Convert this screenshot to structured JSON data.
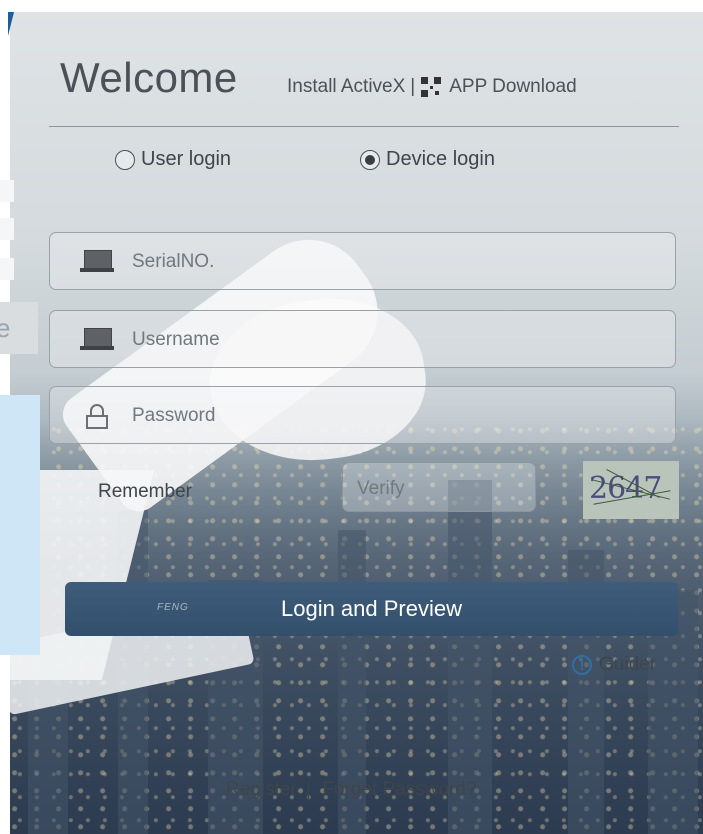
{
  "header": {
    "welcome": "Welcome",
    "install_activex": "Install ActiveX",
    "separator": "|",
    "app_download": "APP Download"
  },
  "login_mode": {
    "options": [
      {
        "label": "User login",
        "selected": false
      },
      {
        "label": "Device login",
        "selected": true
      }
    ]
  },
  "form": {
    "serial_placeholder": "SerialNO.",
    "username_placeholder": "Username",
    "password_placeholder": "Password",
    "remember_label": "Remember",
    "verify_placeholder": "Verify",
    "captcha_text": "2647"
  },
  "login_button": {
    "label": "Login and Preview",
    "watermark": "FENG"
  },
  "guider": {
    "label": "Guider",
    "icon": "info-circle-icon"
  },
  "footer": {
    "register": "Register",
    "separator": "|",
    "forget_password": "Forget Password?"
  },
  "colors": {
    "button_bg": "#3a5774",
    "accent": "#2f6fa7",
    "text": "#3e454b"
  }
}
